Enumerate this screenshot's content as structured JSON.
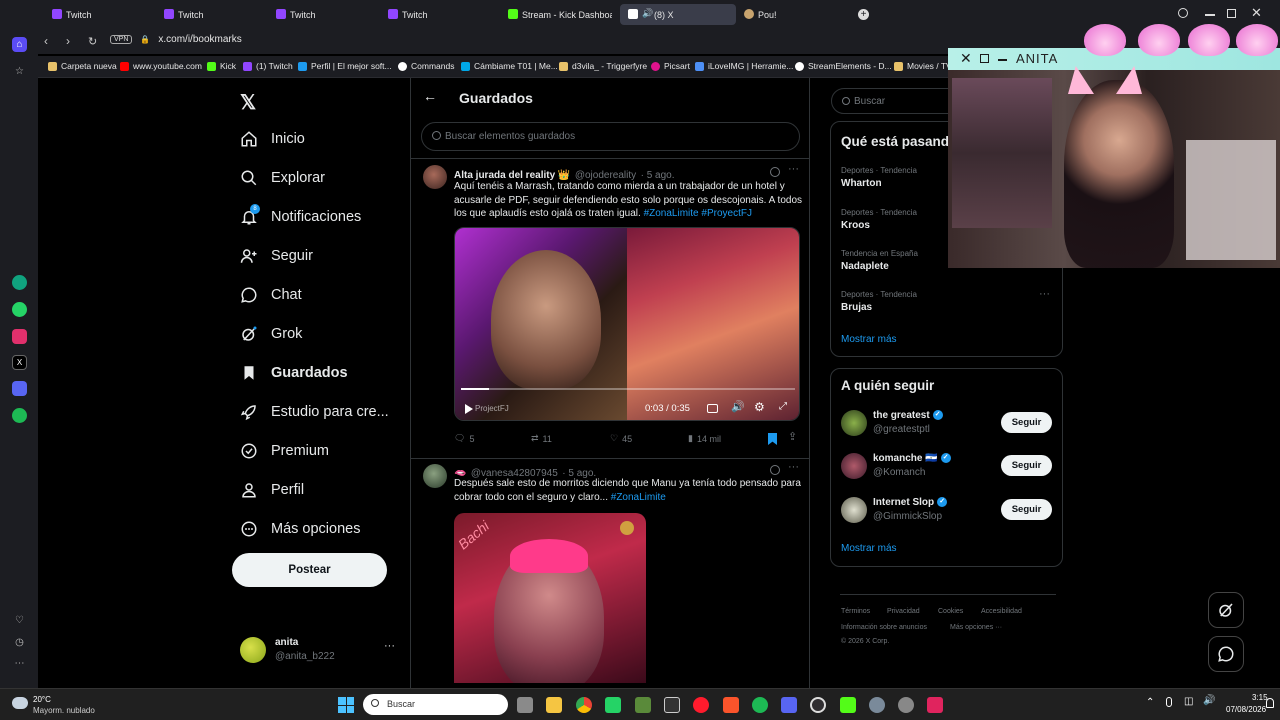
{
  "tabs": [
    {
      "label": "Twitch",
      "color": "#9146ff"
    },
    {
      "label": "Twitch",
      "color": "#9146ff"
    },
    {
      "label": "Twitch",
      "color": "#9146ff"
    },
    {
      "label": "Twitch",
      "color": "#9146ff"
    },
    {
      "label": "Stream - Kick Dashboard",
      "color": "#53fc18"
    },
    {
      "label": "(8) X",
      "color": "#ffffff"
    },
    {
      "label": "Pou!",
      "color": "#c8a46e"
    }
  ],
  "address": {
    "vpn": "VPN",
    "url": "x.com/i/bookmarks"
  },
  "bookmarks": [
    {
      "label": "Carpeta nueva",
      "color": "#e8c26a"
    },
    {
      "label": "www.youtube.com",
      "color": "#ff0000"
    },
    {
      "label": "Kick",
      "color": "#53fc18"
    },
    {
      "label": "(1) Twitch",
      "color": "#9146ff"
    },
    {
      "label": "Perfil | El mejor soft...",
      "color": "#1d9bf0"
    },
    {
      "label": "Commands",
      "color": "#ffffff"
    },
    {
      "label": "Cámbiame T01 | Me...",
      "color": "#00a8e8"
    },
    {
      "label": "d3vila_ - Triggerfyre",
      "color": "#e8c26a"
    },
    {
      "label": "Picsart",
      "color": "#e0138c"
    },
    {
      "label": "iLoveIMG | Herramie...",
      "color": "#4d8ff5"
    },
    {
      "label": "StreamElements - D...",
      "color": "#ffffff"
    },
    {
      "label": "Movies / TV",
      "color": "#e8c26a"
    }
  ],
  "nav": {
    "items": [
      {
        "label": "Inicio",
        "icon": "home-icon"
      },
      {
        "label": "Explorar",
        "icon": "search-icon"
      },
      {
        "label": "Notificaciones",
        "icon": "bell-icon",
        "badge": "8"
      },
      {
        "label": "Seguir",
        "icon": "person-plus-icon"
      },
      {
        "label": "Chat",
        "icon": "chat-icon"
      },
      {
        "label": "Grok",
        "icon": "grok-icon"
      },
      {
        "label": "Guardados",
        "icon": "bookmark-icon"
      },
      {
        "label": "Estudio para cre...",
        "icon": "rocket-icon"
      },
      {
        "label": "Premium",
        "icon": "verified-icon"
      },
      {
        "label": "Perfil",
        "icon": "person-icon"
      },
      {
        "label": "Más opciones",
        "icon": "more-icon"
      }
    ],
    "post_label": "Postear",
    "account": {
      "name": "anita",
      "handle": "@anita_b222"
    }
  },
  "center": {
    "title": "Guardados",
    "search_placeholder": "Buscar elementos guardados",
    "tweets": [
      {
        "name": "Alta jurada del reality 👑",
        "handle": "@ojodereality",
        "time": "· 5 ago.",
        "text": "Aquí tenéis a Marrash, tratando como mierda a un trabajador de un hotel y acusarle de PDF, seguir defendiendo esto solo porque os descojonais. A todos los que aplaudís esto ojalá os traten igual.",
        "tags": "#ZonaLimite #ProyectFJ",
        "video_time": "0:03 / 0:35",
        "video_label": "ProjectFJ",
        "replies": "5",
        "retweets": "11",
        "likes": "45",
        "views": "14 mil"
      },
      {
        "name": "🫦",
        "handle": "@vanesa42807945",
        "time": "· 5 ago.",
        "text": "Después sale esto de morritos diciendo que Manu ya tenía todo pensado para cobrar todo con el seguro y claro...",
        "tags": "#ZonaLimite",
        "image_text": "Bachi"
      }
    ]
  },
  "right": {
    "search_placeholder": "Buscar",
    "trends_title": "Qué está pasando",
    "trends": [
      {
        "category": "Deportes · Tendencia",
        "name": "Wharton"
      },
      {
        "category": "Deportes · Tendencia",
        "name": "Kroos"
      },
      {
        "category": "Tendencia en España",
        "name": "Nadaplete"
      },
      {
        "category": "Deportes · Tendencia",
        "name": "Brujas"
      }
    ],
    "show_more": "Mostrar más",
    "who_title": "A quién seguir",
    "who": [
      {
        "name": "the greatest",
        "handle": "@greatestptl",
        "button": "Seguir"
      },
      {
        "name": "komanche 🇸🇻",
        "handle": "@Komanch",
        "button": "Seguir"
      },
      {
        "name": "Internet Slop",
        "handle": "@GimmickSlop",
        "button": "Seguir"
      }
    ],
    "footer": [
      "Términos",
      "Privacidad",
      "Cookies",
      "Accesibilidad",
      "Información sobre anuncios",
      "Más opciones ···",
      "© 2026 X Corp."
    ]
  },
  "overlay": {
    "title": "ANITA"
  },
  "taskbar": {
    "weather_temp": "20°C",
    "weather_desc": "Mayorm. nublado",
    "search_placeholder": "Buscar",
    "time": "3:15",
    "date": "07/08/2026"
  },
  "colors": {
    "accent": "#1d9bf0",
    "background": "#000000",
    "border": "#2f3336"
  }
}
